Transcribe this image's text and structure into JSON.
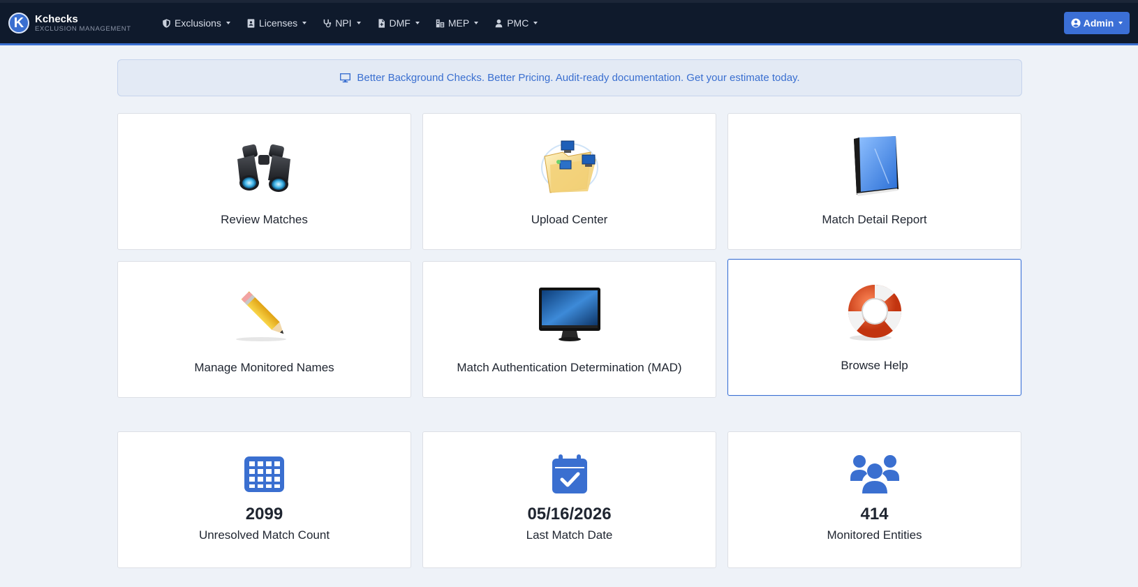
{
  "brand": {
    "logo_letter": "K",
    "name": "Kchecks",
    "subtitle": "EXCLUSION MANAGEMENT"
  },
  "nav": {
    "items": [
      {
        "label": "Exclusions",
        "icon": "shield-icon"
      },
      {
        "label": "Licenses",
        "icon": "id-badge-icon"
      },
      {
        "label": "NPI",
        "icon": "stethoscope-icon"
      },
      {
        "label": "DMF",
        "icon": "file-icon"
      },
      {
        "label": "MEP",
        "icon": "users-gear-icon"
      },
      {
        "label": "PMC",
        "icon": "user-icon"
      }
    ],
    "admin_label": "Admin"
  },
  "banner": {
    "text": "Better Background Checks.  Better Pricing.  Audit-ready documentation. Get your estimate today.",
    "icon": "monitor-icon"
  },
  "cards": [
    {
      "label": "Review Matches",
      "icon": "binoculars-icon"
    },
    {
      "label": "Upload Center",
      "icon": "network-folder-icon"
    },
    {
      "label": "Match Detail Report",
      "icon": "book-icon"
    },
    {
      "label": "Manage Monitored Names",
      "icon": "pencil-icon"
    },
    {
      "label": "Match Authentication Determination (MAD)",
      "icon": "monitor-display-icon"
    },
    {
      "label": "Browse Help",
      "icon": "lifebuoy-icon"
    }
  ],
  "stats": [
    {
      "value": "2099",
      "label": "Unresolved Match Count",
      "icon": "calendar-grid-icon"
    },
    {
      "value": "05/16/2026",
      "label": "Last Match Date",
      "icon": "calendar-check-icon"
    },
    {
      "value": "414",
      "label": "Monitored Entities",
      "icon": "users-icon"
    }
  ],
  "colors": {
    "navbar": "#0f1a2c",
    "accent": "#3a6fd0",
    "page_bg": "#eef2f8"
  }
}
